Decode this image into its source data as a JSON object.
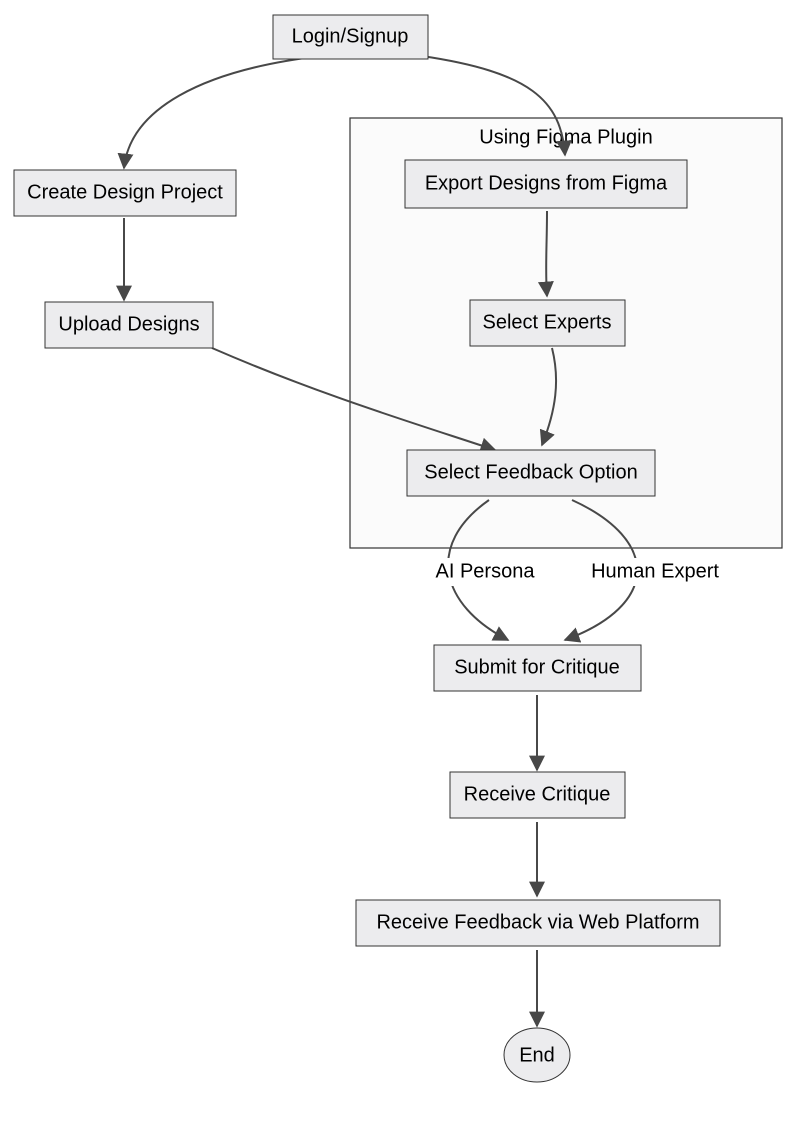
{
  "diagram": {
    "type": "flowchart",
    "subgraph": {
      "title": "Using Figma Plugin"
    },
    "nodes": {
      "login": {
        "label": "Login/Signup"
      },
      "create": {
        "label": "Create Design Project"
      },
      "upload": {
        "label": "Upload Designs"
      },
      "export": {
        "label": "Export Designs from Figma"
      },
      "experts": {
        "label": "Select Experts"
      },
      "option": {
        "label": "Select Feedback Option"
      },
      "submit": {
        "label": "Submit for Critique"
      },
      "receive": {
        "label": "Receive Critique"
      },
      "webfb": {
        "label": "Receive Feedback via Web Platform"
      },
      "end": {
        "label": "End"
      }
    },
    "edge_labels": {
      "ai_persona": "AI Persona",
      "human_expert": "Human Expert"
    }
  }
}
